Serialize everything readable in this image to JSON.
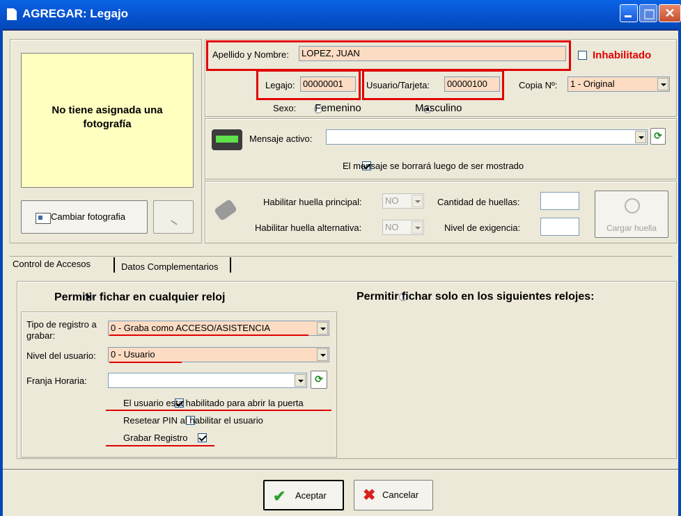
{
  "window": {
    "title": "AGREGAR: Legajo"
  },
  "photo": {
    "text": "No tiene asignada una fotografía",
    "change_button": "Cambiar fotografia"
  },
  "person": {
    "name_label": "Apellido y Nombre:",
    "name_value": "LOPEZ, JUAN",
    "disabled_label": "Inhabilitado",
    "disabled_checked": false,
    "legajo_label": "Legajo:",
    "legajo_value": "00000001",
    "user_label": "Usuario/Tarjeta:",
    "user_value": "00000100",
    "copy_label": "Copia Nº:",
    "copy_value": "1 - Original",
    "sex_label": "Sexo:",
    "sex_female": "Femenino",
    "sex_male": "Masculino",
    "sex_selected": "Masculino"
  },
  "message": {
    "label": "Mensaje activo:",
    "value": "",
    "erase_label": "El mensaje se borrará luego de ser mostrado",
    "erase_checked": true
  },
  "fingerprint": {
    "main_label": "Habilitar huella principal:",
    "main_value": "NO",
    "alt_label": "Habilitar huella alternativa:",
    "alt_value": "NO",
    "count_label": "Cantidad de huellas:",
    "count_value": "",
    "level_label": "Nivel de exigencia:",
    "level_value": "",
    "load_button": "Cargar huella"
  },
  "tabs": [
    {
      "label": "Control de Accesos",
      "active": true
    },
    {
      "label": "Datos Complementarios",
      "active": false
    }
  ],
  "access": {
    "any_clock_label": "Permitir fichar en cualquier reloj",
    "any_clock_selected": true,
    "some_clocks_label": "Permitir fichar solo en los siguientes relojes:",
    "record_type_label": "Tipo de registro a grabar:",
    "record_type_value": "0 - Graba como ACCESO/ASISTENCIA",
    "user_level_label": "Nivel del usuario:",
    "user_level_value": "0 - Usuario",
    "time_slot_label": "Franja Horaria:",
    "time_slot_value": "",
    "door_label": "El usuario esta habilitado para abrir la puerta",
    "door_checked": true,
    "pin_label": "Resetear PIN al habilitar el usuario",
    "pin_checked": false,
    "record_label": "Grabar Registro",
    "record_checked": true
  },
  "footer": {
    "accept": "Aceptar",
    "cancel": "Cancelar"
  },
  "colors": {
    "titlebar": "#0A64E6",
    "highlight": "#E00000",
    "peach": "#FCDCC3",
    "photo_bg": "#FFFFC0"
  }
}
